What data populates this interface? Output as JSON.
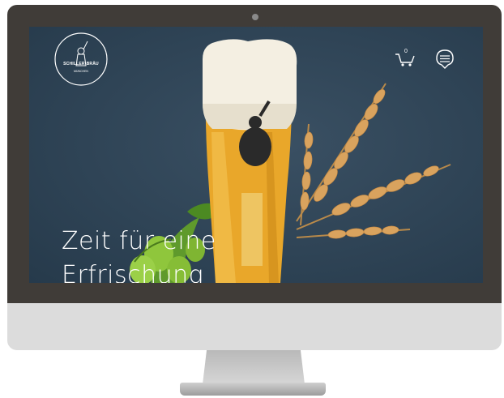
{
  "brand": {
    "logo_text": "SCHILLER-BRÄU",
    "logo_subtext": "MÜNCHEN"
  },
  "header": {
    "cart_count": "0",
    "cart_icon": "cart-icon",
    "menu_icon": "menu-icon"
  },
  "hero": {
    "headline_line1": "Zeit für eine",
    "headline_line2": "Erfrischung"
  },
  "colors": {
    "screen_background": "#2f4456",
    "bezel": "#403c38",
    "chin": "#dcdcdc"
  }
}
